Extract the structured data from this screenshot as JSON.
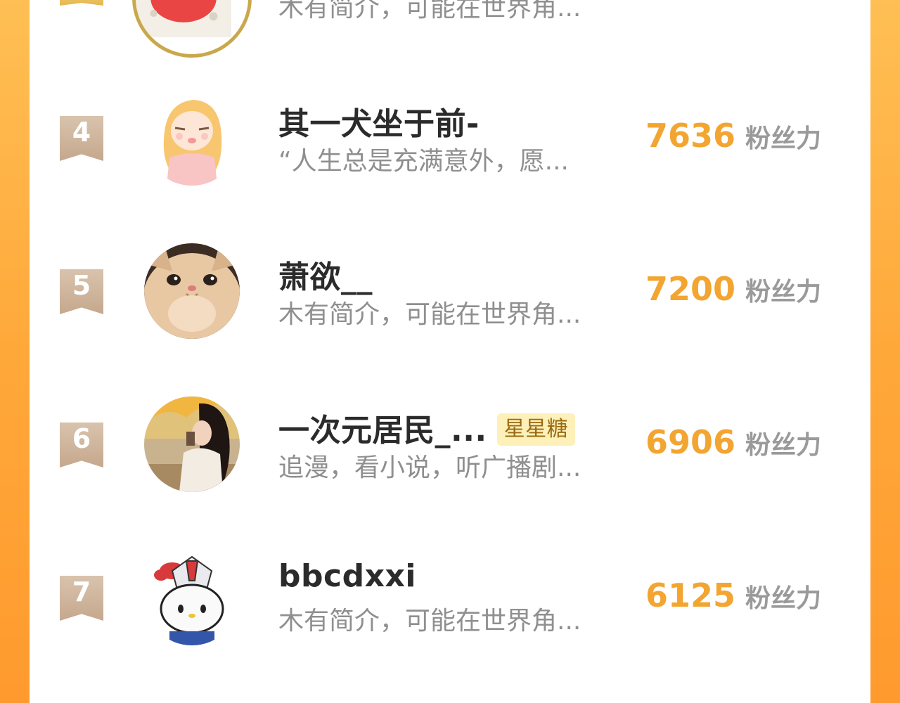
{
  "colors": {
    "accent_score": "#f3a531",
    "name_text": "#2b2b2b",
    "bio_text": "#8f8f8f",
    "unit_text": "#9a9a9a",
    "badge_bg": "#fdf0b8",
    "page_bg": "#ffa83a"
  },
  "ranking": {
    "unit_label": "粉丝力",
    "top_partial": {
      "bio": "木有简介，可能在世界角..."
    },
    "entries": [
      {
        "rank": "4",
        "name": "其一犬坐于前-",
        "badge": "",
        "bio": "“人生总是充满意外，愿...",
        "score": "7636",
        "avatar_icon": "anime-girl-avatar"
      },
      {
        "rank": "5",
        "name": "萧欲__",
        "badge": "",
        "bio": "木有简介，可能在世界角...",
        "score": "7200",
        "avatar_icon": "cat-avatar"
      },
      {
        "rank": "6",
        "name": "一次元居民_...",
        "badge": "星星糖",
        "bio": "追漫，看小说，听广播剧...",
        "score": "6906",
        "avatar_icon": "girl-autumn-avatar"
      },
      {
        "rank": "7",
        "name": "bbcdxxi",
        "badge": "",
        "bio": "木有简介，可能在世界角...",
        "score": "6125",
        "avatar_icon": "robot-kitty-avatar"
      }
    ]
  }
}
